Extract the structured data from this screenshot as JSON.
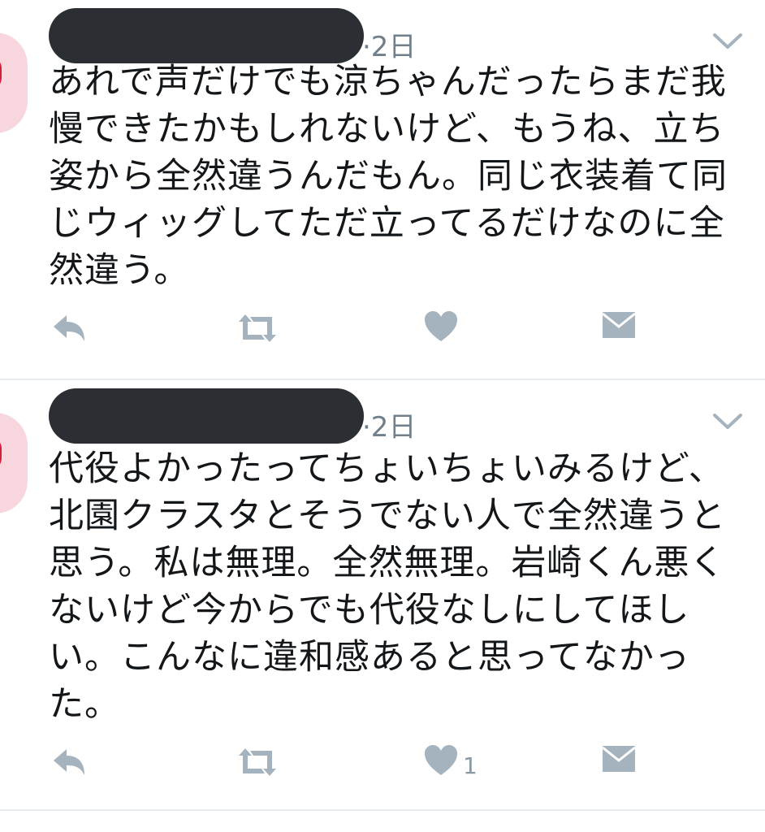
{
  "tweets": [
    {
      "timestamp": "·2日",
      "text": "あれで声だけでも涼ちゃんだったらまだ我慢できたかもしれないけど、もうね、立ち姿から全然違うんだもん。同じ衣装着て同じウィッグしてただ立ってるだけなのに全然違う。",
      "like_count": ""
    },
    {
      "timestamp": "·2日",
      "text": "代役よかったってちょいちょいみるけど、北園クラスタとそうでない人で全然違うと思う。私は無理。全然無理。岩崎くん悪くないけど今からでも代役なしにしてほしい。こんなに違和感あると思ってなかった。",
      "like_count": "1"
    }
  ],
  "icons": {
    "reply": "reply-icon",
    "retweet": "retweet-icon",
    "like": "heart-icon",
    "dm": "envelope-icon",
    "menu": "chevron-down-icon"
  },
  "colors": {
    "icon_gray": "#a5b3bf",
    "text": "#14171a",
    "meta": "#707f8a",
    "redaction": "#2b2f33",
    "divider": "#e6ecf0"
  }
}
